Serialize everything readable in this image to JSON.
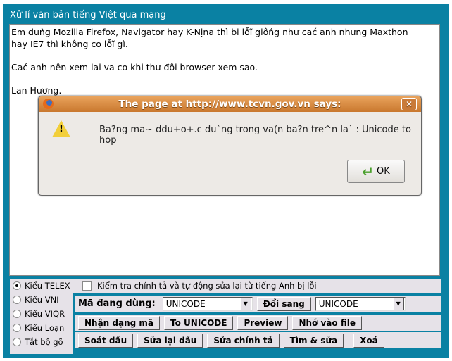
{
  "header": {
    "title": "Xử lí văn bản tiếng Việt qua mạng"
  },
  "editor": {
    "lines": [
      "Em duǹg Mozilla Firefox, Navigator hay K-Nịna thì bi lỗĩ giôńg như cać anh nhưng Maxthon",
      "hay IE7 thì không co lỗĩ gì.",
      "",
      "Cać anh nên xem lai va co khi thư đôi browser xem sao.",
      "",
      "Lan Hương."
    ]
  },
  "dialog": {
    "title": "The page at http://www.tcvn.gov.vn says:",
    "message": "Ba?ng ma~ ddu+o+.c du`ng trong va(n ba?n tre^n la` : Unicode to hop",
    "ok": "OK"
  },
  "input_modes": [
    {
      "label": "Kiểu TELEX",
      "selected": true
    },
    {
      "label": "Kiểu VNI",
      "selected": false
    },
    {
      "label": "Kiểu VIQR",
      "selected": false
    },
    {
      "label": "Kiểu Loạn",
      "selected": false
    },
    {
      "label": "Tắt bộ gõ",
      "selected": false
    }
  ],
  "spellcheck": {
    "label": "Kiểm tra chính tả và tự động sửa lại từ tiếng Anh bị lỗi",
    "checked": false
  },
  "encoding": {
    "label": "Mã đang dùng:",
    "from": "UNICODE",
    "convert": "Đổi sang",
    "to": "UNICODE"
  },
  "buttons_row2": [
    "Nhận dạng mã",
    "To UNICODE",
    "Preview",
    "Nhớ vào file"
  ],
  "buttons_row3": [
    "Soát dấu",
    "Sửa lại dấu",
    "Sửa chính tả",
    "Tìm & sửa",
    "Xoá"
  ]
}
